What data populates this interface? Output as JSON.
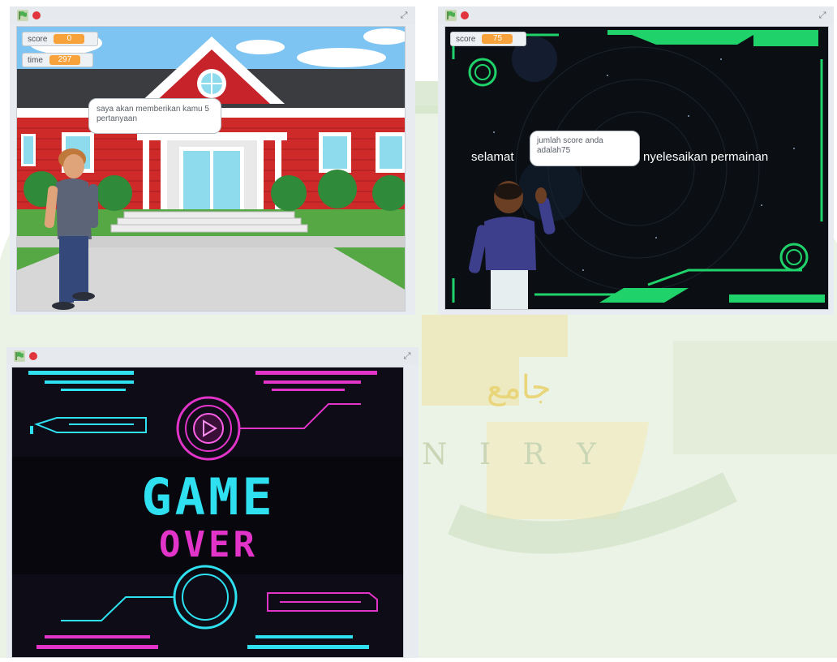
{
  "windows": [
    {
      "monitors": [
        {
          "label": "score",
          "value": "0"
        },
        {
          "label": "time",
          "value": "297"
        }
      ],
      "speech": "saya akan memberikan kamu 5 pertanyaan"
    },
    {
      "monitors": [
        {
          "label": "score",
          "value": "75"
        }
      ],
      "speech": "jumlah score anda adalah75",
      "credits_left": "selamat",
      "credits_right": "nyelesaikan permainan"
    },
    {
      "title_line1": "GAME",
      "title_line2": "OVER"
    }
  ],
  "watermark": {
    "arabic_text": "جامع",
    "latin_text": "N I R Y"
  },
  "colors": {
    "flag_green": "#4caf50",
    "stop_red": "#e0353c",
    "monitor_orange": "#f7a23a",
    "neon_cyan": "#2fe0f0",
    "neon_magenta": "#e234c8",
    "neon_green": "#1fd36a"
  },
  "icons": {
    "flag": "green-flag-icon",
    "stop": "stop-icon",
    "fullscreen": "fullscreen-icon"
  }
}
